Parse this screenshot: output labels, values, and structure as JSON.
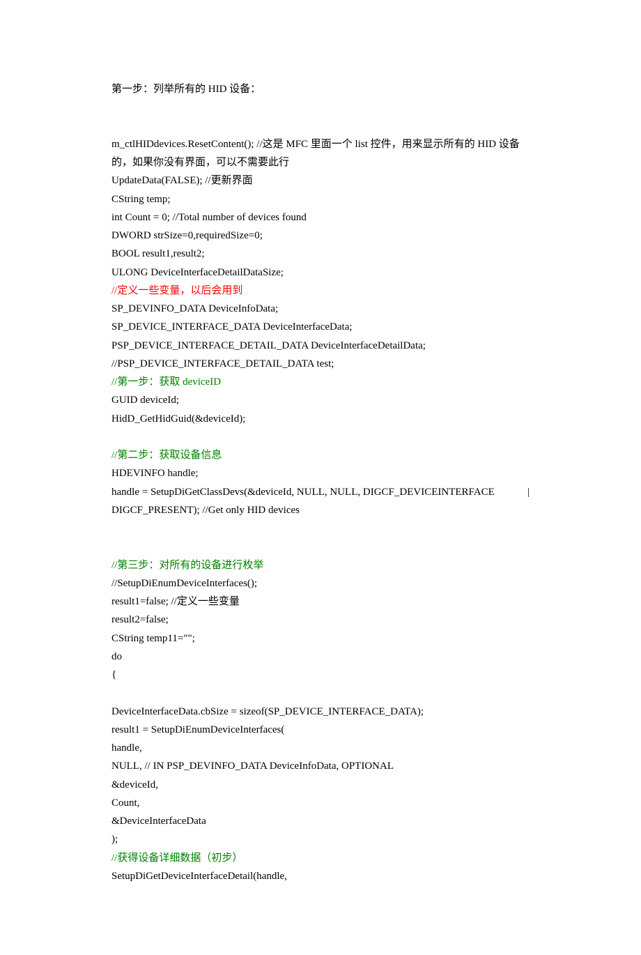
{
  "lines": [
    {
      "id": "l1",
      "text": "第一步：列举所有的 HID 设备：",
      "cls": ""
    },
    {
      "id": "b1",
      "blank": true
    },
    {
      "id": "b2",
      "blank": true
    },
    {
      "id": "l2a",
      "spread": true,
      "left": "m_ctlHIDdevices.ResetContent(); //这是 MFC 里面一个 list 控件，用来显示所有的 HID 设备",
      "right": ""
    },
    {
      "id": "l2b",
      "text": "的，如果你没有界面，可以不需要此行",
      "cls": ""
    },
    {
      "id": "l3",
      "text": "UpdateData(FALSE); //更新界面",
      "cls": ""
    },
    {
      "id": "l4",
      "text": "CString temp;",
      "cls": ""
    },
    {
      "id": "l5",
      "text": "int Count = 0; //Total number of devices found",
      "cls": ""
    },
    {
      "id": "l6",
      "text": "DWORD strSize=0,requiredSize=0;",
      "cls": ""
    },
    {
      "id": "l7",
      "text": "BOOL result1,result2;",
      "cls": ""
    },
    {
      "id": "l8",
      "text": "ULONG DeviceInterfaceDetailDataSize;",
      "cls": ""
    },
    {
      "id": "l9",
      "text": "//定义一些变量，以后会用到",
      "cls": "red"
    },
    {
      "id": "l10",
      "text": "SP_DEVINFO_DATA DeviceInfoData;",
      "cls": ""
    },
    {
      "id": "l11",
      "text": "SP_DEVICE_INTERFACE_DATA DeviceInterfaceData;",
      "cls": ""
    },
    {
      "id": "l12",
      "text": "PSP_DEVICE_INTERFACE_DETAIL_DATA DeviceInterfaceDetailData;",
      "cls": ""
    },
    {
      "id": "l13",
      "text": "//PSP_DEVICE_INTERFACE_DETAIL_DATA test;",
      "cls": ""
    },
    {
      "id": "l14",
      "text": "//第一步：获取 deviceID",
      "cls": "green"
    },
    {
      "id": "l15",
      "text": "GUID deviceId;",
      "cls": ""
    },
    {
      "id": "l16",
      "text": "HidD_GetHidGuid(&deviceId);",
      "cls": ""
    },
    {
      "id": "b3",
      "blank": true
    },
    {
      "id": "l17",
      "text": "//第二步：获取设备信息",
      "cls": "green"
    },
    {
      "id": "l18",
      "text": "HDEVINFO handle;",
      "cls": ""
    },
    {
      "id": "l19",
      "spread": true,
      "left": "handle  =  SetupDiGetClassDevs(&deviceId,  NULL,  NULL,  DIGCF_DEVICEINTERFACE",
      "right": "|"
    },
    {
      "id": "l20",
      "text": "DIGCF_PRESENT); //Get only HID devices",
      "cls": ""
    },
    {
      "id": "b4",
      "blank": true
    },
    {
      "id": "b5",
      "blank": true
    },
    {
      "id": "l21",
      "text": "//第三步：对所有的设备进行枚举",
      "cls": "green"
    },
    {
      "id": "l22",
      "text": "//SetupDiEnumDeviceInterfaces();",
      "cls": ""
    },
    {
      "id": "l23",
      "text": "result1=false; //定义一些变量",
      "cls": ""
    },
    {
      "id": "l24",
      "text": "result2=false;",
      "cls": ""
    },
    {
      "id": "l25",
      "text": "CString temp11=\"\";",
      "cls": ""
    },
    {
      "id": "l26",
      "text": "do",
      "cls": ""
    },
    {
      "id": "l27",
      "text": "{",
      "cls": ""
    },
    {
      "id": "b6",
      "blank": true
    },
    {
      "id": "l28",
      "text": "DeviceInterfaceData.cbSize = sizeof(SP_DEVICE_INTERFACE_DATA);",
      "cls": ""
    },
    {
      "id": "l29",
      "text": "result1 = SetupDiEnumDeviceInterfaces(",
      "cls": ""
    },
    {
      "id": "l30",
      "text": "handle,",
      "cls": ""
    },
    {
      "id": "l31",
      "text": "NULL, // IN PSP_DEVINFO_DATA DeviceInfoData, OPTIONAL",
      "cls": ""
    },
    {
      "id": "l32",
      "text": "&deviceId,",
      "cls": ""
    },
    {
      "id": "l33",
      "text": "Count,",
      "cls": ""
    },
    {
      "id": "l34",
      "text": "&DeviceInterfaceData",
      "cls": ""
    },
    {
      "id": "l35",
      "text": ");",
      "cls": ""
    },
    {
      "id": "l36",
      "text": "//获得设备详细数据（初步）",
      "cls": "green"
    },
    {
      "id": "l37",
      "text": "SetupDiGetDeviceInterfaceDetail(handle,",
      "cls": ""
    }
  ]
}
